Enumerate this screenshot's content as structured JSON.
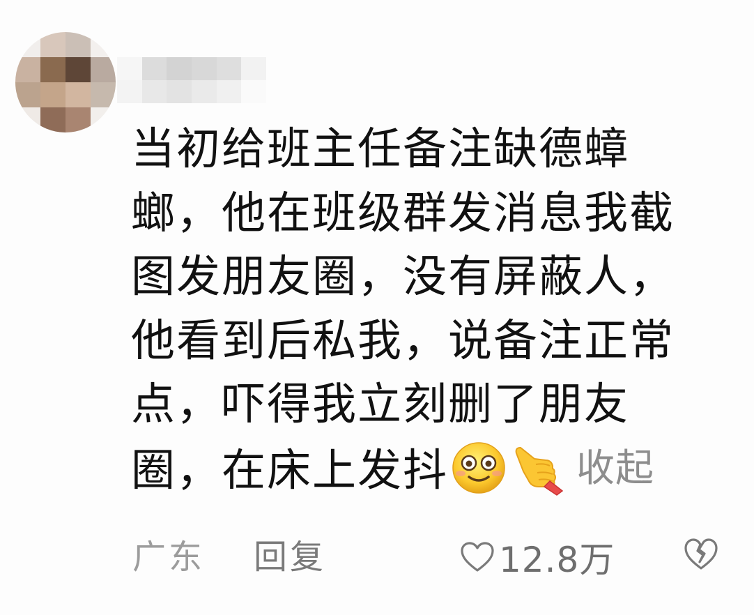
{
  "comment": {
    "lines": [
      "当初给班主任备注缺德蟑",
      "螂，他在班级群发消息我截",
      "图发朋友圈，没有屏蔽人，",
      "他看到后私我，说备注正常",
      "点，吓得我立刻删了朋友",
      "圈，在床上发抖"
    ],
    "emojis": [
      "smiling-face-emoji",
      "pointing-hand-emoji"
    ],
    "collapse_label": "收起"
  },
  "footer": {
    "location": "广东",
    "reply_label": "回复",
    "like_count": "12.8万"
  },
  "colors": {
    "text": "#111111",
    "muted": "#8d8d8d",
    "icon_stroke": "#7a7a7a"
  }
}
